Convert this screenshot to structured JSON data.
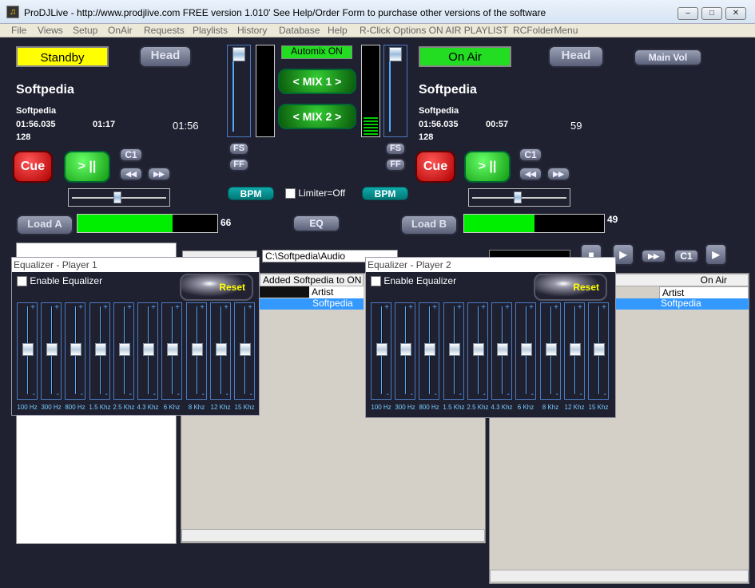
{
  "window": {
    "title": "ProDJLive - http://www.prodjlive.com FREE version 1.010' See Help/Order Form to purchase other versions of the software",
    "icon": "app-icon",
    "min": "–",
    "max": "□",
    "close": "✕"
  },
  "menu": [
    "File",
    "Views",
    "Setup",
    "OnAir",
    "Requests",
    "Playlists",
    "History",
    "Database",
    "Help",
    "R-Click Options ON AIR PLAYLIST",
    "RCFolderMenu"
  ],
  "deckA": {
    "status": "Standby",
    "head": "Head",
    "title": "Softpedia",
    "artist": "Softpedia",
    "time1": "01:56.035",
    "time2": "01:17",
    "time3": "01:56",
    "bpm": "128",
    "cue": "Cue",
    "play": "> ||",
    "c1": "C1",
    "rew": "◀◀",
    "ffw": "▶▶",
    "load": "Load A",
    "volume": "66",
    "volume_level": 0.68
  },
  "deckB": {
    "status": "On Air",
    "head": "Head",
    "title": "Softpedia",
    "artist": "Softpedia",
    "time1": "01:56.035",
    "time2": "00:57",
    "time3": "59",
    "bpm": "128",
    "cue": "Cue",
    "play": "> ||",
    "c1": "C1",
    "rew": "◀◀",
    "ffw": "▶▶",
    "load": "Load B",
    "volume": "49",
    "volume_level": 0.5,
    "mainvol": "Main Vol"
  },
  "center": {
    "automix": "Automix ON",
    "mix1": "< MIX 1 >",
    "mix2": "< MIX 2 >",
    "fs": "FS",
    "ff": "FF",
    "bpm": "BPM",
    "limiter": "Limiter=Off",
    "eq": "EQ"
  },
  "path": "C:\\Softpedia\\Audio",
  "playlist": {
    "header_added": "Added Softpedia to ON",
    "col_artist": "Artist",
    "row_artist": "Softpedia"
  },
  "onair": {
    "header": "On Air",
    "col_artist": "Artist",
    "row_artist": "Softpedia"
  },
  "eq1": {
    "title": "Equalizer - Player 1",
    "enable": "Enable Equalizer",
    "reset": "Reset"
  },
  "eq2": {
    "title": "Equalizer - Player 2",
    "enable": "Enable Equalizer",
    "reset": "Reset"
  },
  "eq_bands": [
    "100 Hz",
    "300 Hz",
    "800 Hz",
    "1.5 Khz",
    "2.5 Khz",
    "4.3 Khz",
    "6 Khz",
    "8 Khz",
    "12 Khz",
    "15 Khz"
  ],
  "colors": {
    "background": "#1f2030",
    "standby": "#ffff00",
    "onair": "#22dd22",
    "volume": "#00ee00",
    "cue": "#cc0000",
    "selection": "#3399ff"
  }
}
